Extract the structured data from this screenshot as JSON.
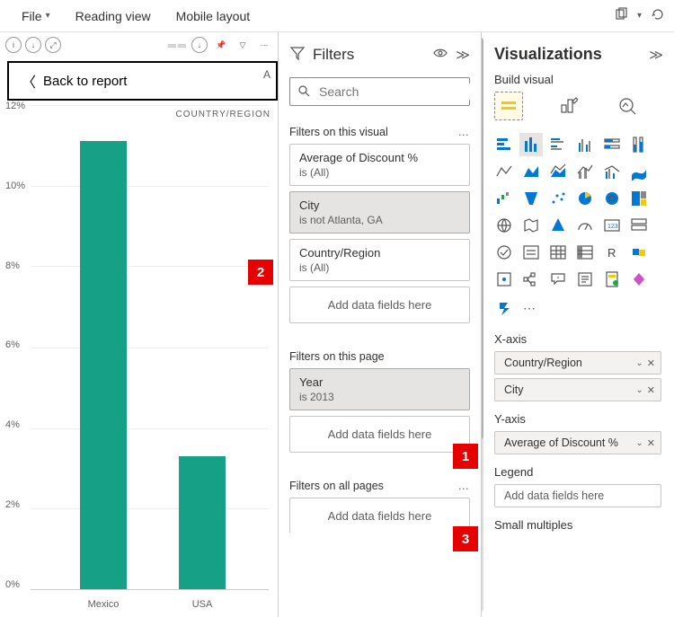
{
  "top_menu": {
    "file": "File",
    "reading_view": "Reading view",
    "mobile_layout": "Mobile layout"
  },
  "back_button": "Back to report",
  "cutoff_label_a": "A",
  "cutoff_label_b": "COUNTRY/REGION",
  "chart_data": {
    "type": "bar",
    "categories": [
      "Mexico",
      "USA"
    ],
    "values": [
      11.1,
      3.3
    ],
    "ylabel": "%",
    "ylim": [
      0,
      12
    ],
    "yticks": [
      "12%",
      "10%",
      "8%",
      "6%",
      "4%",
      "2%",
      "0%"
    ]
  },
  "filters": {
    "title": "Filters",
    "search_placeholder": "Search",
    "sections": {
      "visual": {
        "title": "Filters on this visual",
        "items": [
          {
            "name": "Average of Discount %",
            "value": "is (All)"
          },
          {
            "name": "City",
            "value": "is not Atlanta, GA"
          },
          {
            "name": "Country/Region",
            "value": "is (All)"
          }
        ],
        "add": "Add data fields here"
      },
      "page": {
        "title": "Filters on this page",
        "items": [
          {
            "name": "Year",
            "value": "is 2013"
          }
        ],
        "add": "Add data fields here"
      },
      "all": {
        "title": "Filters on all pages",
        "add": "Add data fields here"
      }
    }
  },
  "viz": {
    "title": "Visualizations",
    "subtitle": "Build visual",
    "fields": {
      "xaxis": {
        "label": "X-axis",
        "items": [
          "Country/Region",
          "City"
        ]
      },
      "yaxis": {
        "label": "Y-axis",
        "items": [
          "Average of Discount %"
        ]
      },
      "legend": {
        "label": "Legend",
        "add": "Add data fields here"
      },
      "small_mult": {
        "label": "Small multiples"
      }
    }
  },
  "markers": {
    "m1": "1",
    "m2": "2",
    "m3": "3"
  }
}
